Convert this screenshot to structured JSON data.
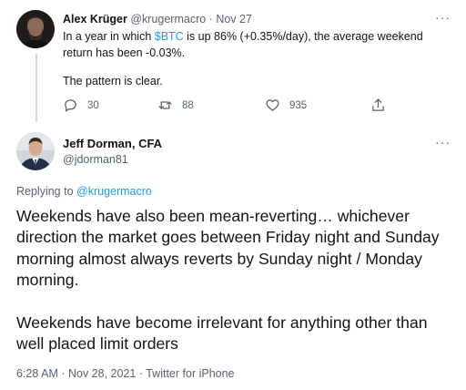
{
  "parent_tweet": {
    "author_name": "Alex Krüger",
    "author_handle": "@krugermacro",
    "separator": " · ",
    "date": "Nov 27",
    "text_before_tag": "In a year in which ",
    "cashtag": "$BTC",
    "text_after_tag": " is up 86% (+0.35%/day), the average weekend return has been -0.03%.",
    "text_second": "The pattern is clear.",
    "reply_count": "30",
    "retweet_count": "88",
    "like_count": "935",
    "more_glyph": "···"
  },
  "main_tweet": {
    "author_name": "Jeff Dorman, CFA",
    "author_handle": "@jdorman81",
    "replying_prefix": "Replying to ",
    "replying_handle": "@krugermacro",
    "paragraph_1": "Weekends have also been mean-reverting… whichever direction the market goes between Friday night and Sunday morning almost always reverts by Sunday night / Monday morning.",
    "paragraph_2": "Weekends have become irrelevant for anything other than well placed limit orders",
    "timestamp": "6:28 AM · Nov 28, 2021",
    "separator": " · ",
    "source": "Twitter for iPhone",
    "more_glyph": "···"
  },
  "icons": {
    "reply": "reply-icon",
    "retweet": "retweet-icon",
    "like": "heart-icon",
    "share": "share-icon"
  },
  "colors": {
    "link": "#1d9bf0",
    "secondary_text": "#536471",
    "primary_text": "#0f1419",
    "thread_line": "#cfd9de"
  }
}
